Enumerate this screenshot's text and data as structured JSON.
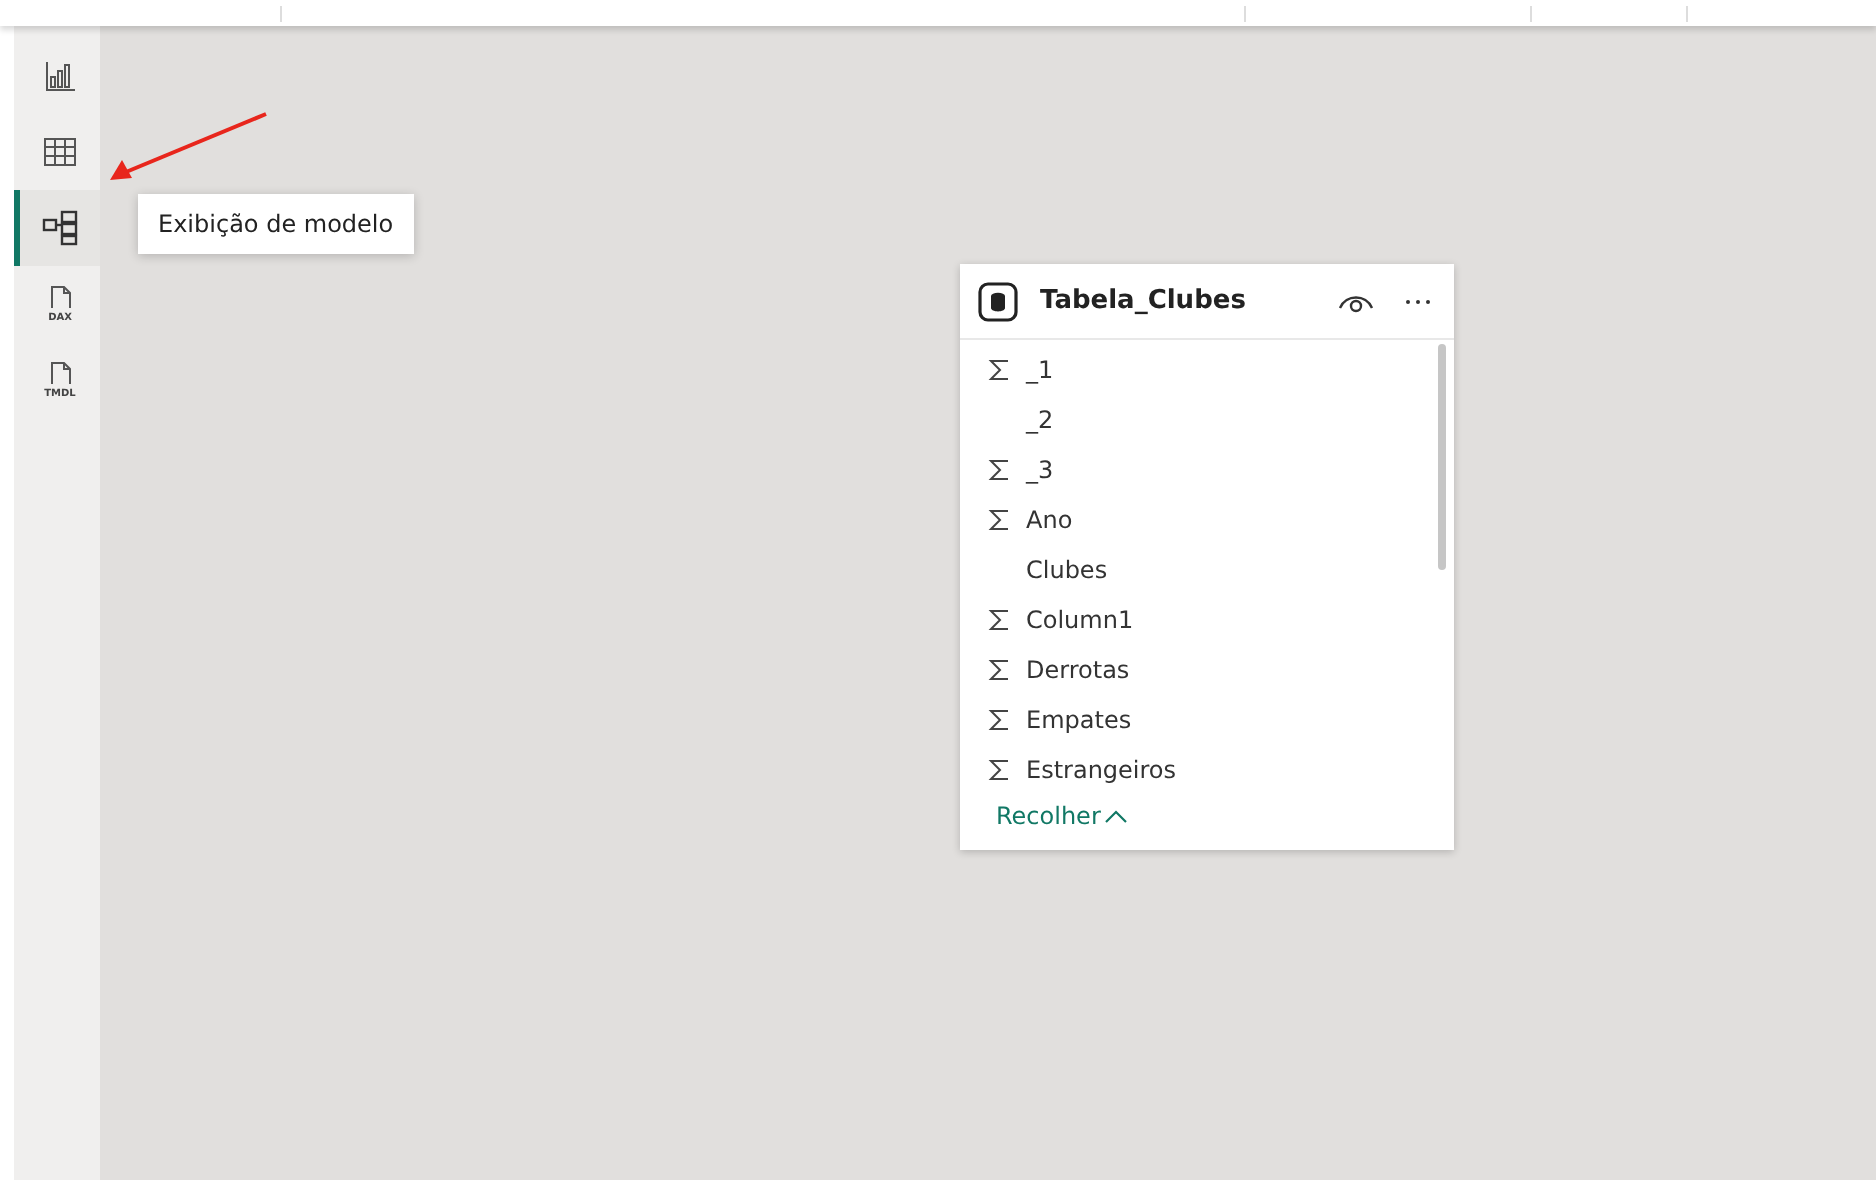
{
  "sidebar": {
    "items": [
      {
        "kind": "report",
        "selected": false
      },
      {
        "kind": "table",
        "selected": false
      },
      {
        "kind": "model",
        "selected": true,
        "tooltip": "Exibição de modelo"
      },
      {
        "kind": "dax",
        "label": "DAX",
        "selected": false
      },
      {
        "kind": "tmdl",
        "label": "TMDL",
        "selected": false
      }
    ]
  },
  "table_card": {
    "title": "Tabela_Clubes",
    "fields": [
      {
        "name": "_1",
        "summarized": true
      },
      {
        "name": "_2",
        "summarized": false
      },
      {
        "name": "_3",
        "summarized": true
      },
      {
        "name": "Ano",
        "summarized": true
      },
      {
        "name": "Clubes",
        "summarized": false
      },
      {
        "name": "Column1",
        "summarized": true
      },
      {
        "name": "Derrotas",
        "summarized": true
      },
      {
        "name": "Empates",
        "summarized": true
      },
      {
        "name": "Estrangeiros",
        "summarized": true
      }
    ],
    "collapse_link": "Recolher"
  }
}
